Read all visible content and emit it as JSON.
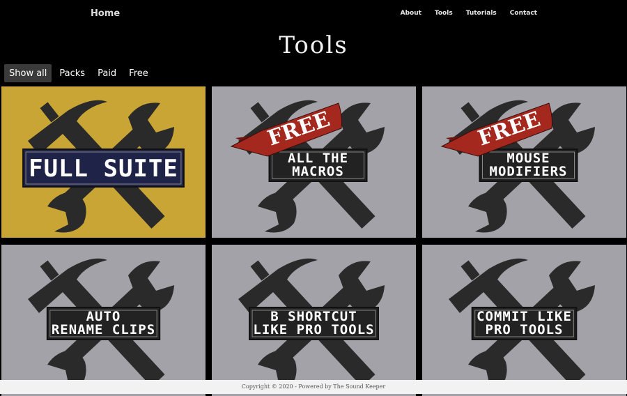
{
  "nav": {
    "home": "Home",
    "links": [
      {
        "label": "About"
      },
      {
        "label": "Tools"
      },
      {
        "label": "Tutorials"
      },
      {
        "label": "Contact"
      }
    ]
  },
  "page": {
    "title": "Tools"
  },
  "filters": {
    "items": [
      {
        "label": "Show all",
        "active": true
      },
      {
        "label": "Packs"
      },
      {
        "label": "Paid"
      },
      {
        "label": "Free"
      }
    ]
  },
  "tiles": [
    {
      "lines": [
        "FULL SUITE"
      ],
      "ribbon": "",
      "bg": "#c9a535",
      "plate": "#202348",
      "text_color": "#ffffff"
    },
    {
      "lines": [
        "ALL THE",
        "MACROS"
      ],
      "ribbon": "FREE",
      "bg": "#a2a2a8",
      "plate": "#222222",
      "text_color": "#ffffff"
    },
    {
      "lines": [
        "MOUSE",
        "MODIFIERS"
      ],
      "ribbon": "FREE",
      "bg": "#a2a2a8",
      "plate": "#222222",
      "text_color": "#ffffff"
    },
    {
      "lines": [
        "AUTO",
        "RENAME CLIPS"
      ],
      "ribbon": "",
      "bg": "#a2a2a8",
      "plate": "#222222",
      "text_color": "#ffffff"
    },
    {
      "lines": [
        "B SHORTCUT",
        "LIKE PRO TOOLS"
      ],
      "ribbon": "",
      "bg": "#a2a2a8",
      "plate": "#222222",
      "text_color": "#ffffff"
    },
    {
      "lines": [
        "COMMIT LIKE",
        "PRO TOOLS"
      ],
      "ribbon": "",
      "bg": "#a2a2a8",
      "plate": "#222222",
      "text_color": "#ffffff"
    }
  ],
  "footer": {
    "text": "Copyright © 2020 - Powered by The Sound Keeper"
  },
  "colors": {
    "ribbon": "#a5281e",
    "icon": "#2a2a2a",
    "background": "#000000"
  }
}
